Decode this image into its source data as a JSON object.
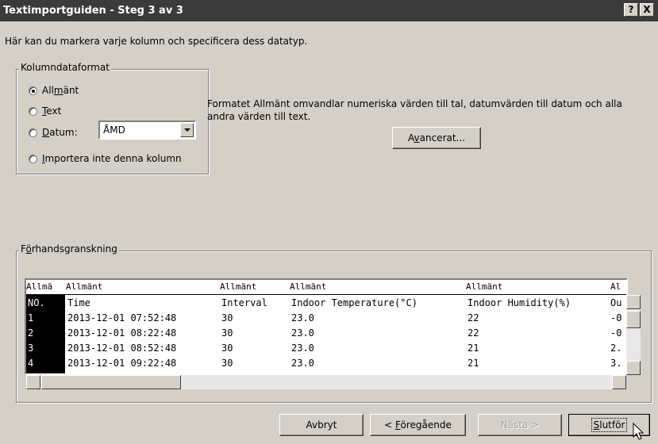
{
  "window": {
    "title": "Textimportguiden - Steg 3 av 3",
    "help_btn": "?",
    "close_btn": "X"
  },
  "intro": "Här kan du markera varje kolumn och specificera dess datatyp.",
  "format_group": {
    "legend": "Kolumndataformat",
    "options": [
      {
        "pre": "All",
        "ul": "m",
        "post": "änt",
        "selected": true
      },
      {
        "pre": "",
        "ul": "T",
        "post": "ext",
        "selected": false
      },
      {
        "pre": "",
        "ul": "D",
        "post": "atum:",
        "selected": false
      },
      {
        "pre": "",
        "ul": "I",
        "post": "mportera inte denna kolumn",
        "selected": false
      }
    ],
    "date_format": "ÅMD"
  },
  "description": "Formatet Allmänt omvandlar numeriska värden till tal, datumvärden till datum och alla andra värden till text.",
  "advanced_button": {
    "pre": "A",
    "ul": "v",
    "post": "ancerat..."
  },
  "preview": {
    "legend_pre": "F",
    "legend_ul": "ö",
    "legend_post": "rhandsgranskning",
    "headers": [
      "Allmä",
      "Allmänt",
      "Allmänt",
      "Allmänt",
      "Allmänt",
      "Al"
    ],
    "rows": [
      [
        "NO.",
        "Time",
        "Interval",
        "Indoor Temperature(°C)",
        "Indoor Humidity(%)",
        "Ou"
      ],
      [
        "1",
        "2013-12-01 07:52:48",
        "30",
        "23.0",
        "22",
        "-0"
      ],
      [
        "2",
        "2013-12-01 08:22:48",
        "30",
        "23.0",
        "22",
        "-0"
      ],
      [
        "3",
        "2013-12-01 08:52:48",
        "30",
        "23.0",
        "21",
        "2."
      ],
      [
        "4",
        "2013-12-01 09:22:48",
        "30",
        "23.0",
        "21",
        "3."
      ]
    ]
  },
  "buttons": {
    "cancel": "Avbryt",
    "back_pre": "< ",
    "back_ul": "F",
    "back_post": "öregående",
    "next": "Nästa >",
    "finish_ul": "S",
    "finish_post": "lutför"
  }
}
